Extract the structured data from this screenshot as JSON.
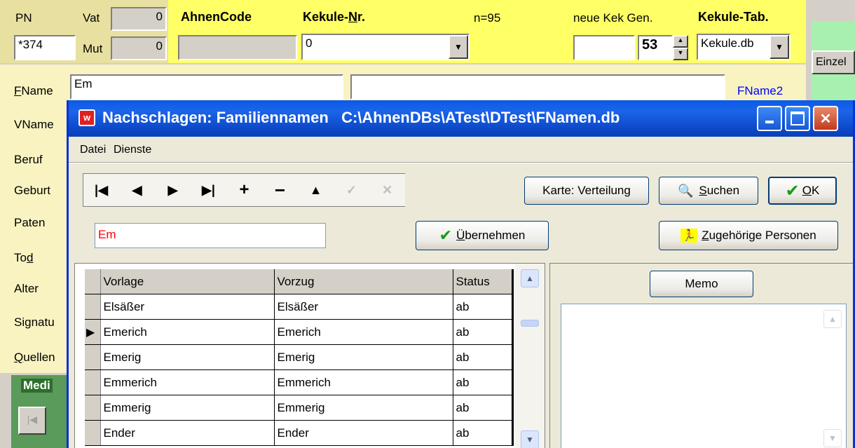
{
  "top": {
    "pn_label": "PN",
    "pn_value": "*374",
    "vat_label": "Vat",
    "vat_value": "0",
    "mut_label": "Mut",
    "mut_value": "0",
    "ahnencode_label": "AhnenCode",
    "kekule_nr_label_pre": "Kekule-",
    "kekule_nr_label_ul": "N",
    "kekule_nr_label_post": "r.",
    "kekule_nr_value": "0",
    "n_count": "n=95",
    "neue_kek_gen_label": "neue Kek Gen.",
    "gen_value": "53",
    "kekule_tab_label": "Kekule-Tab.",
    "kekule_tab_value": "Kekule.db",
    "einzel_label": "Einzel"
  },
  "form": {
    "fname_label_ul": "F",
    "fname_label_rest": "Name",
    "fname_value": "Em",
    "fname2_label": "FName2",
    "labels": [
      "VName",
      "Beruf",
      "Geburt",
      "Paten",
      "Tod",
      "Alter",
      "Signatu",
      "Quellen"
    ],
    "tod_label_pre": "To",
    "tod_label_ul": "d",
    "quellen_label_ul": "Q",
    "quellen_label_rest": "uellen",
    "medi_label": "Medi"
  },
  "dialog": {
    "title": "Nachschlagen: Familiennamen   C:\\AhnenDBs\\ATest\\DTest\\FNamen.db",
    "menu": [
      "Datei",
      "Dienste"
    ],
    "nav_buttons": [
      "first-icon",
      "prior-icon",
      "next-icon",
      "last-icon",
      "insert-icon",
      "delete-icon",
      "edit-icon",
      "post-icon",
      "cancel-icon"
    ],
    "karte_button": "Karte: Verteilung",
    "suchen_ul": "S",
    "suchen_rest": "uchen",
    "ok_ul": "O",
    "ok_rest": "K",
    "search_value": "Em",
    "uebernehmen_ul": "Ü",
    "uebernehmen_rest": "bernehmen",
    "zugehoerige_ul": "Z",
    "zugehoerige_rest": "ugehörige Personen",
    "memo_button": "Memo",
    "grid": {
      "columns": [
        "Vorlage",
        "Vorzug",
        "Status"
      ],
      "rows": [
        {
          "vorlage": "Elsäßer",
          "vorzug": "Elsäßer",
          "status": "ab",
          "current": false
        },
        {
          "vorlage": "Emerich",
          "vorzug": "Emerich",
          "status": "ab",
          "current": true
        },
        {
          "vorlage": "Emerig",
          "vorzug": "Emerig",
          "status": "ab",
          "current": false
        },
        {
          "vorlage": "Emmerich",
          "vorzug": "Emmerich",
          "status": "ab",
          "current": false
        },
        {
          "vorlage": "Emmerig",
          "vorzug": "Emmerig",
          "status": "ab",
          "current": false
        },
        {
          "vorlage": "Ender",
          "vorzug": "Ender",
          "status": "ab",
          "current": false
        }
      ]
    }
  },
  "colors": {
    "yellow_panel": "#ffff66",
    "form_bg": "#f8f3c0",
    "green_panel": "#a8f0b0",
    "titlebar": "#0a5ae8",
    "search_text": "#ff0000",
    "link_blue": "#0000ff"
  }
}
